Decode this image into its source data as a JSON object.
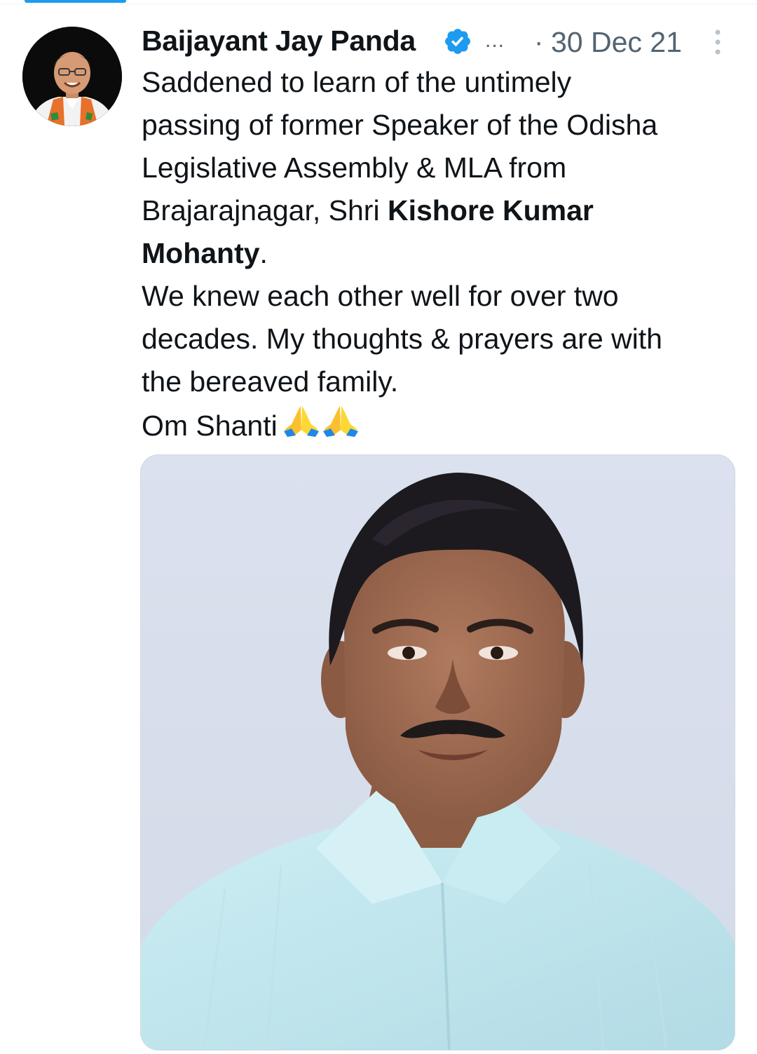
{
  "tweet": {
    "author": {
      "name": "Baijayant Jay Panda",
      "verified": true,
      "handle_truncated": "...",
      "avatar_icon": "profile-photo"
    },
    "separator": "·",
    "timestamp": "30 Dec 21",
    "more_icon": "vertical-ellipsis-icon",
    "text": {
      "line1": "Saddened to learn of the untimely",
      "line2": "passing of former Speaker of the Odisha",
      "line3": "Legislative Assembly & MLA from",
      "line4_prefix": "Brajarajnagar, Shri ",
      "line4_bold": "Kishore Kumar",
      "line5_bold": "Mohanty",
      "line5_suffix": ".",
      "line6": "We knew each other well for over two",
      "line7": "decades. My thoughts & prayers are with",
      "line8": "the bereaved family.",
      "line9": "Om Shanti"
    },
    "media": {
      "type": "photo",
      "icon": "portrait-photo"
    }
  },
  "colors": {
    "accent": "#1d9bf0",
    "text_primary": "#0f1419",
    "text_secondary": "#536471",
    "photo_background": "#d8dfec",
    "shirt": "#c4e6ee"
  }
}
